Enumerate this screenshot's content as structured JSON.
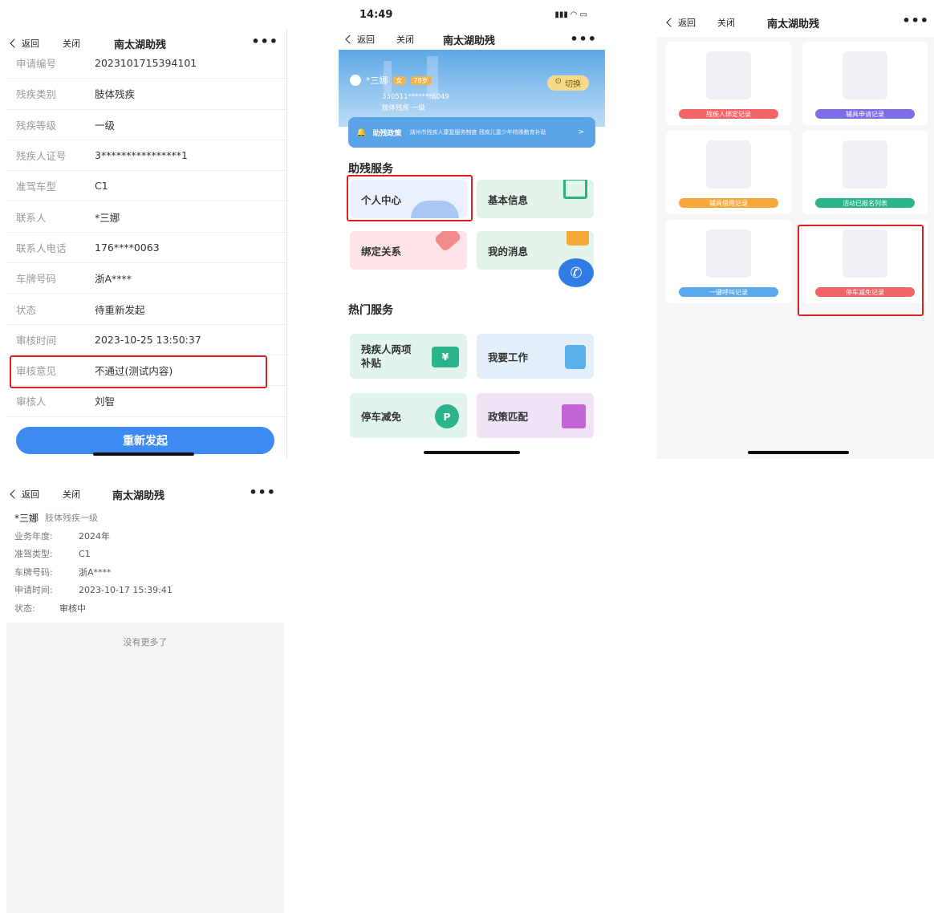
{
  "nav": {
    "back": "返回",
    "close": "关闭",
    "title": "南太湖助残",
    "more": "•••"
  },
  "s1": {
    "rows": [
      {
        "k": "申请编号",
        "v": "2023101715394101"
      },
      {
        "k": "残疾类别",
        "v": "肢体残疾"
      },
      {
        "k": "残疾等级",
        "v": "一级"
      },
      {
        "k": "残疾人证号",
        "v": "3****************1"
      },
      {
        "k": "准驾车型",
        "v": "C1"
      },
      {
        "k": "联系人",
        "v": "*三娜"
      },
      {
        "k": "联系人电话",
        "v": "176****0063"
      },
      {
        "k": "车牌号码",
        "v": "浙A****"
      },
      {
        "k": "状态",
        "v": "待重新发起"
      },
      {
        "k": "审核时间",
        "v": "2023-10-25 13:50:37"
      },
      {
        "k": "审核意见",
        "v": "不通过(测试内容)"
      },
      {
        "k": "审核人",
        "v": "刘智"
      }
    ],
    "button": "重新发起"
  },
  "s2": {
    "status_time": "14:49",
    "status_icons": "▮▮▮ ◠ ▭",
    "user": {
      "name": "*三娜",
      "gender": "女",
      "age": "78岁",
      "id": "330511*******6049",
      "desc": "肢体残疾 一级",
      "switch": "切换"
    },
    "notice": {
      "label": "助残政策",
      "text": "湖州市残疾人康复服务制度 残疾儿童少年特殊教育补助标准",
      "arrow": ">"
    },
    "section1": "助残服务",
    "tiles1": [
      "个人中心",
      "基本信息",
      "绑定关系",
      "我的消息"
    ],
    "section2": "热门服务",
    "tiles2": [
      "残疾人两项补贴",
      "我要工作",
      "停车减免",
      "政策匹配"
    ],
    "glyph_yen": "¥",
    "glyph_p": "P"
  },
  "s3": {
    "cards": [
      "残疾人绑定记录",
      "辅具申请记录",
      "辅具借用记录",
      "活动已报名列表",
      "一键呼叫记录",
      "停车减免记录"
    ]
  },
  "s4": {
    "name": "*三娜",
    "disability": "肢体残疾一级",
    "fields": [
      {
        "k": "业务年度:",
        "v": "2024年"
      },
      {
        "k": "准驾类型:",
        "v": "C1"
      },
      {
        "k": "车牌号码:",
        "v": "浙A****"
      },
      {
        "k": "申请时间:",
        "v": "2023-10-17 15:39:41"
      }
    ],
    "status_label": "状态:",
    "status_value": "审核中",
    "empty": "没有更多了"
  },
  "colors": {
    "primary": "#3d8bf0",
    "highlight": "#e02020"
  }
}
